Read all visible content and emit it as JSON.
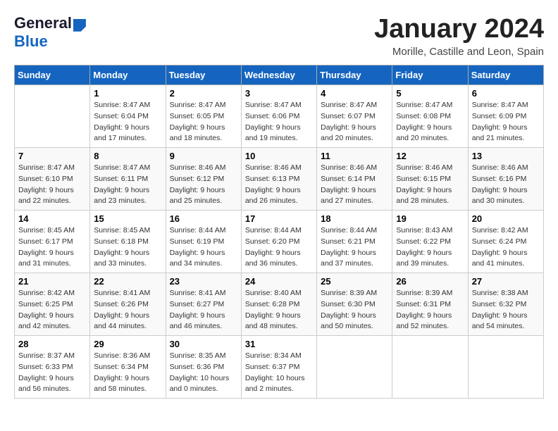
{
  "logo": {
    "general": "General",
    "blue": "Blue"
  },
  "title": "January 2024",
  "location": "Morille, Castille and Leon, Spain",
  "weekdays": [
    "Sunday",
    "Monday",
    "Tuesday",
    "Wednesday",
    "Thursday",
    "Friday",
    "Saturday"
  ],
  "weeks": [
    [
      {
        "day": "",
        "info": ""
      },
      {
        "day": "1",
        "info": "Sunrise: 8:47 AM\nSunset: 6:04 PM\nDaylight: 9 hours\nand 17 minutes."
      },
      {
        "day": "2",
        "info": "Sunrise: 8:47 AM\nSunset: 6:05 PM\nDaylight: 9 hours\nand 18 minutes."
      },
      {
        "day": "3",
        "info": "Sunrise: 8:47 AM\nSunset: 6:06 PM\nDaylight: 9 hours\nand 19 minutes."
      },
      {
        "day": "4",
        "info": "Sunrise: 8:47 AM\nSunset: 6:07 PM\nDaylight: 9 hours\nand 20 minutes."
      },
      {
        "day": "5",
        "info": "Sunrise: 8:47 AM\nSunset: 6:08 PM\nDaylight: 9 hours\nand 20 minutes."
      },
      {
        "day": "6",
        "info": "Sunrise: 8:47 AM\nSunset: 6:09 PM\nDaylight: 9 hours\nand 21 minutes."
      }
    ],
    [
      {
        "day": "7",
        "info": "Sunrise: 8:47 AM\nSunset: 6:10 PM\nDaylight: 9 hours\nand 22 minutes."
      },
      {
        "day": "8",
        "info": "Sunrise: 8:47 AM\nSunset: 6:11 PM\nDaylight: 9 hours\nand 23 minutes."
      },
      {
        "day": "9",
        "info": "Sunrise: 8:46 AM\nSunset: 6:12 PM\nDaylight: 9 hours\nand 25 minutes."
      },
      {
        "day": "10",
        "info": "Sunrise: 8:46 AM\nSunset: 6:13 PM\nDaylight: 9 hours\nand 26 minutes."
      },
      {
        "day": "11",
        "info": "Sunrise: 8:46 AM\nSunset: 6:14 PM\nDaylight: 9 hours\nand 27 minutes."
      },
      {
        "day": "12",
        "info": "Sunrise: 8:46 AM\nSunset: 6:15 PM\nDaylight: 9 hours\nand 28 minutes."
      },
      {
        "day": "13",
        "info": "Sunrise: 8:46 AM\nSunset: 6:16 PM\nDaylight: 9 hours\nand 30 minutes."
      }
    ],
    [
      {
        "day": "14",
        "info": "Sunrise: 8:45 AM\nSunset: 6:17 PM\nDaylight: 9 hours\nand 31 minutes."
      },
      {
        "day": "15",
        "info": "Sunrise: 8:45 AM\nSunset: 6:18 PM\nDaylight: 9 hours\nand 33 minutes."
      },
      {
        "day": "16",
        "info": "Sunrise: 8:44 AM\nSunset: 6:19 PM\nDaylight: 9 hours\nand 34 minutes."
      },
      {
        "day": "17",
        "info": "Sunrise: 8:44 AM\nSunset: 6:20 PM\nDaylight: 9 hours\nand 36 minutes."
      },
      {
        "day": "18",
        "info": "Sunrise: 8:44 AM\nSunset: 6:21 PM\nDaylight: 9 hours\nand 37 minutes."
      },
      {
        "day": "19",
        "info": "Sunrise: 8:43 AM\nSunset: 6:22 PM\nDaylight: 9 hours\nand 39 minutes."
      },
      {
        "day": "20",
        "info": "Sunrise: 8:42 AM\nSunset: 6:24 PM\nDaylight: 9 hours\nand 41 minutes."
      }
    ],
    [
      {
        "day": "21",
        "info": "Sunrise: 8:42 AM\nSunset: 6:25 PM\nDaylight: 9 hours\nand 42 minutes."
      },
      {
        "day": "22",
        "info": "Sunrise: 8:41 AM\nSunset: 6:26 PM\nDaylight: 9 hours\nand 44 minutes."
      },
      {
        "day": "23",
        "info": "Sunrise: 8:41 AM\nSunset: 6:27 PM\nDaylight: 9 hours\nand 46 minutes."
      },
      {
        "day": "24",
        "info": "Sunrise: 8:40 AM\nSunset: 6:28 PM\nDaylight: 9 hours\nand 48 minutes."
      },
      {
        "day": "25",
        "info": "Sunrise: 8:39 AM\nSunset: 6:30 PM\nDaylight: 9 hours\nand 50 minutes."
      },
      {
        "day": "26",
        "info": "Sunrise: 8:39 AM\nSunset: 6:31 PM\nDaylight: 9 hours\nand 52 minutes."
      },
      {
        "day": "27",
        "info": "Sunrise: 8:38 AM\nSunset: 6:32 PM\nDaylight: 9 hours\nand 54 minutes."
      }
    ],
    [
      {
        "day": "28",
        "info": "Sunrise: 8:37 AM\nSunset: 6:33 PM\nDaylight: 9 hours\nand 56 minutes."
      },
      {
        "day": "29",
        "info": "Sunrise: 8:36 AM\nSunset: 6:34 PM\nDaylight: 9 hours\nand 58 minutes."
      },
      {
        "day": "30",
        "info": "Sunrise: 8:35 AM\nSunset: 6:36 PM\nDaylight: 10 hours\nand 0 minutes."
      },
      {
        "day": "31",
        "info": "Sunrise: 8:34 AM\nSunset: 6:37 PM\nDaylight: 10 hours\nand 2 minutes."
      },
      {
        "day": "",
        "info": ""
      },
      {
        "day": "",
        "info": ""
      },
      {
        "day": "",
        "info": ""
      }
    ]
  ]
}
